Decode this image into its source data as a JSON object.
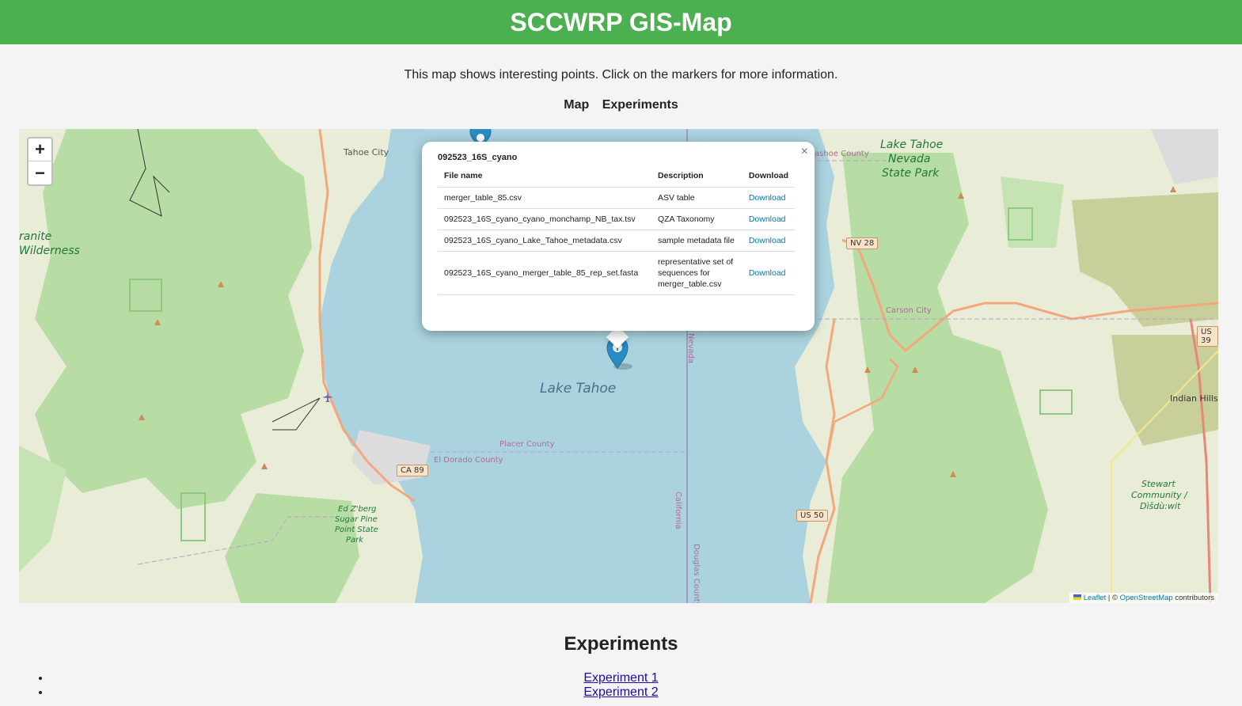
{
  "header": {
    "title": "SCCWRP GIS-Map"
  },
  "intro": "This map shows interesting points. Click on the markers for more information.",
  "nav": {
    "map": "Map",
    "experiments": "Experiments"
  },
  "map": {
    "zoom_in": "+",
    "zoom_out": "−",
    "labels": {
      "tahoe_city": "Tahoe City",
      "granite": "ranite",
      "wilderness": "Wilderness",
      "lake_tahoe": "Lake Tahoe",
      "placer": "Placer County",
      "eldorado": "El Dorado County",
      "washoe": "ashoe County",
      "carson_city": "Carson City",
      "indian_hills": "Indian Hills",
      "nevada": "Nevada",
      "california": "California",
      "douglas": "Douglas County",
      "park1": "Lake Tahoe",
      "park2": "Nevada",
      "park3": "State Park",
      "sugar1": "Ed Z'berg",
      "sugar2": "Sugar Pine",
      "sugar3": "Point State",
      "sugar4": "Park",
      "stewart1": "Stewart",
      "stewart2": "Community /",
      "stewart3": "Dìšdù:wit"
    },
    "shields": {
      "nv28": "NV 28",
      "ca89": "CA 89",
      "us50": "US 50",
      "us395": "US 39"
    },
    "attribution": {
      "leaflet": "Leaflet",
      "sep": " | © ",
      "osm": "OpenStreetMap",
      "suffix": " contributors"
    }
  },
  "popup": {
    "title": "092523_16S_cyano",
    "close": "×",
    "headers": [
      "File name",
      "Description",
      "Download"
    ],
    "rows": [
      {
        "file": "merger_table_85.csv",
        "desc": "ASV table",
        "dl": "Download"
      },
      {
        "file": "092523_16S_cyano_cyano_monchamp_NB_tax.tsv",
        "desc": "QZA Taxonomy",
        "dl": "Download"
      },
      {
        "file": "092523_16S_cyano_Lake_Tahoe_metadata.csv",
        "desc": "sample metadata file",
        "dl": "Download"
      },
      {
        "file": "092523_16S_cyano_merger_table_85_rep_set.fasta",
        "desc": "representative set of sequences for merger_table.csv",
        "dl": "Download"
      }
    ]
  },
  "experiments": {
    "title": "Experiments",
    "items": [
      "Experiment 1",
      "Experiment 2"
    ]
  }
}
